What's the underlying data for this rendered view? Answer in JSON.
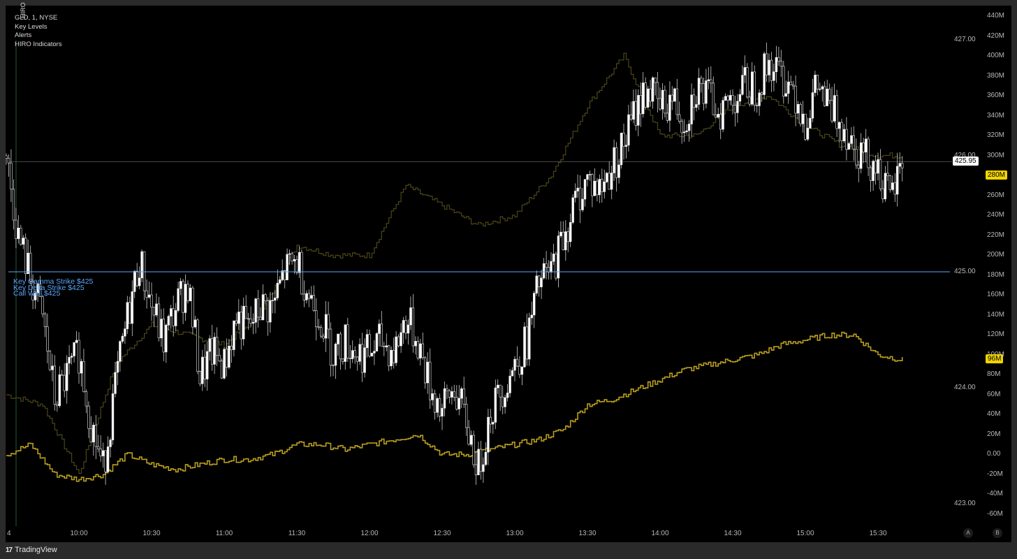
{
  "legend": {
    "symbol": "GLD, 1, NYSE",
    "items": [
      "Key Levels",
      "Alerts",
      "HIRO Indicators"
    ],
    "vertical_text": "HIRO"
  },
  "strike_labels": [
    "Key Gamma Strike $425",
    "Key Delta Strike $425",
    "Call Wall $425"
  ],
  "price_axis": {
    "ticks": [
      "427.00",
      "426.00",
      "425.00",
      "424.00",
      "423.00"
    ],
    "last_price": "425.95",
    "key_level": 425.0
  },
  "volume_axis": {
    "ticks": [
      "440M",
      "420M",
      "400M",
      "380M",
      "360M",
      "340M",
      "320M",
      "300M",
      "280M",
      "260M",
      "240M",
      "220M",
      "200M",
      "180M",
      "160M",
      "140M",
      "120M",
      "100M",
      "80M",
      "60M",
      "40M",
      "20M",
      "0.00",
      "-20M",
      "-40M",
      "-60M"
    ],
    "tag_upper": "280M",
    "tag_lower": "96M"
  },
  "time_axis": {
    "first_label": "4",
    "labels": [
      "10:00",
      "10:30",
      "11:00",
      "11:30",
      "12:00",
      "12:30",
      "13:00",
      "13:30",
      "14:00",
      "14:30",
      "15:00",
      "15:30"
    ]
  },
  "footer": {
    "brand": "TradingView",
    "logo_icon": "tradingview-logo-icon"
  },
  "corner_buttons": [
    "A",
    "B"
  ],
  "colors": {
    "background": "#000000",
    "candle": "#ffffff",
    "hiro_lower": "#b89e1e",
    "hiro_upper": "#4a4618",
    "key_level_line": "#5aa8ff",
    "price_tag_volume": "#f0d400"
  },
  "chart_data": {
    "type": "candlestick",
    "symbol": "GLD",
    "interval": "1",
    "exchange": "NYSE",
    "time_range": [
      "09:30",
      "15:44"
    ],
    "price_range": [
      422.85,
      427.3
    ],
    "volume_range": [
      -70,
      450
    ],
    "price_path": [
      [
        "09:30",
        426.0
      ],
      [
        "09:35",
        425.3
      ],
      [
        "09:45",
        424.6
      ],
      [
        "09:50",
        423.9
      ],
      [
        "10:00",
        424.3
      ],
      [
        "10:05",
        423.7
      ],
      [
        "10:10",
        423.3
      ],
      [
        "10:15",
        424.0
      ],
      [
        "10:20",
        424.6
      ],
      [
        "10:25",
        425.1
      ],
      [
        "10:30",
        424.7
      ],
      [
        "10:35",
        424.4
      ],
      [
        "10:40",
        424.7
      ],
      [
        "10:45",
        424.9
      ],
      [
        "10:50",
        424.1
      ],
      [
        "10:55",
        424.3
      ],
      [
        "11:00",
        424.2
      ],
      [
        "11:05",
        424.6
      ],
      [
        "11:10",
        424.5
      ],
      [
        "11:15",
        424.7
      ],
      [
        "11:20",
        424.7
      ],
      [
        "11:25",
        425.0
      ],
      [
        "11:30",
        425.1
      ],
      [
        "11:35",
        424.8
      ],
      [
        "11:40",
        424.6
      ],
      [
        "11:45",
        424.3
      ],
      [
        "11:50",
        424.4
      ],
      [
        "11:55",
        424.3
      ],
      [
        "12:00",
        424.3
      ],
      [
        "12:05",
        424.4
      ],
      [
        "12:10",
        424.3
      ],
      [
        "12:15",
        424.6
      ],
      [
        "12:20",
        424.4
      ],
      [
        "12:25",
        424.0
      ],
      [
        "12:30",
        423.8
      ],
      [
        "12:35",
        424.0
      ],
      [
        "12:40",
        423.7
      ],
      [
        "12:45",
        423.3
      ],
      [
        "12:50",
        423.8
      ],
      [
        "12:55",
        424.0
      ],
      [
        "13:00",
        424.2
      ],
      [
        "13:05",
        424.4
      ],
      [
        "13:10",
        424.9
      ],
      [
        "13:15",
        425.0
      ],
      [
        "13:20",
        425.3
      ],
      [
        "13:25",
        425.6
      ],
      [
        "13:30",
        425.8
      ],
      [
        "13:35",
        425.7
      ],
      [
        "13:40",
        425.9
      ],
      [
        "13:45",
        426.1
      ],
      [
        "13:50",
        426.4
      ],
      [
        "13:55",
        426.6
      ],
      [
        "14:00",
        426.4
      ],
      [
        "14:05",
        426.5
      ],
      [
        "14:10",
        426.3
      ],
      [
        "14:15",
        426.6
      ],
      [
        "14:20",
        426.5
      ],
      [
        "14:25",
        426.4
      ],
      [
        "14:30",
        426.5
      ],
      [
        "14:35",
        426.6
      ],
      [
        "14:40",
        426.6
      ],
      [
        "14:45",
        426.8
      ],
      [
        "14:50",
        426.7
      ],
      [
        "14:55",
        426.6
      ],
      [
        "15:00",
        426.3
      ],
      [
        "15:05",
        426.6
      ],
      [
        "15:10",
        426.4
      ],
      [
        "15:15",
        426.3
      ],
      [
        "15:20",
        426.1
      ],
      [
        "15:25",
        426.0
      ],
      [
        "15:30",
        425.9
      ],
      [
        "15:35",
        425.6
      ],
      [
        "15:40",
        425.95
      ]
    ],
    "series": [
      {
        "name": "HIRO (lower)",
        "x": [
          "09:30",
          "09:40",
          "09:50",
          "10:00",
          "10:10",
          "10:20",
          "10:30",
          "10:40",
          "10:50",
          "11:00",
          "11:10",
          "11:20",
          "11:30",
          "11:40",
          "11:50",
          "12:00",
          "12:10",
          "12:20",
          "12:30",
          "12:40",
          "12:50",
          "13:00",
          "13:10",
          "13:20",
          "13:30",
          "13:40",
          "13:50",
          "14:00",
          "14:10",
          "14:20",
          "14:30",
          "14:40",
          "14:50",
          "15:00",
          "15:10",
          "15:20",
          "15:30",
          "15:40"
        ],
        "values": [
          0,
          10,
          -20,
          -25,
          -20,
          0,
          -10,
          -15,
          -10,
          -5,
          -5,
          0,
          10,
          10,
          5,
          10,
          15,
          20,
          0,
          0,
          5,
          10,
          15,
          25,
          50,
          55,
          65,
          75,
          85,
          90,
          95,
          100,
          110,
          115,
          120,
          120,
          100,
          95
        ]
      },
      {
        "name": "HIRO (upper)",
        "x": [
          "09:30",
          "09:45",
          "10:00",
          "10:15",
          "10:30",
          "10:45",
          "11:00",
          "11:15",
          "11:30",
          "11:45",
          "12:00",
          "12:15",
          "12:30",
          "12:45",
          "13:00",
          "13:15",
          "13:30",
          "13:45",
          "14:00",
          "14:15",
          "14:30",
          "14:45",
          "15:00",
          "15:15",
          "15:30",
          "15:40"
        ],
        "values": [
          60,
          50,
          -20,
          90,
          130,
          120,
          110,
          140,
          210,
          200,
          200,
          270,
          250,
          230,
          240,
          280,
          350,
          400,
          320,
          320,
          350,
          360,
          330,
          310,
          300,
          300
        ]
      }
    ]
  }
}
